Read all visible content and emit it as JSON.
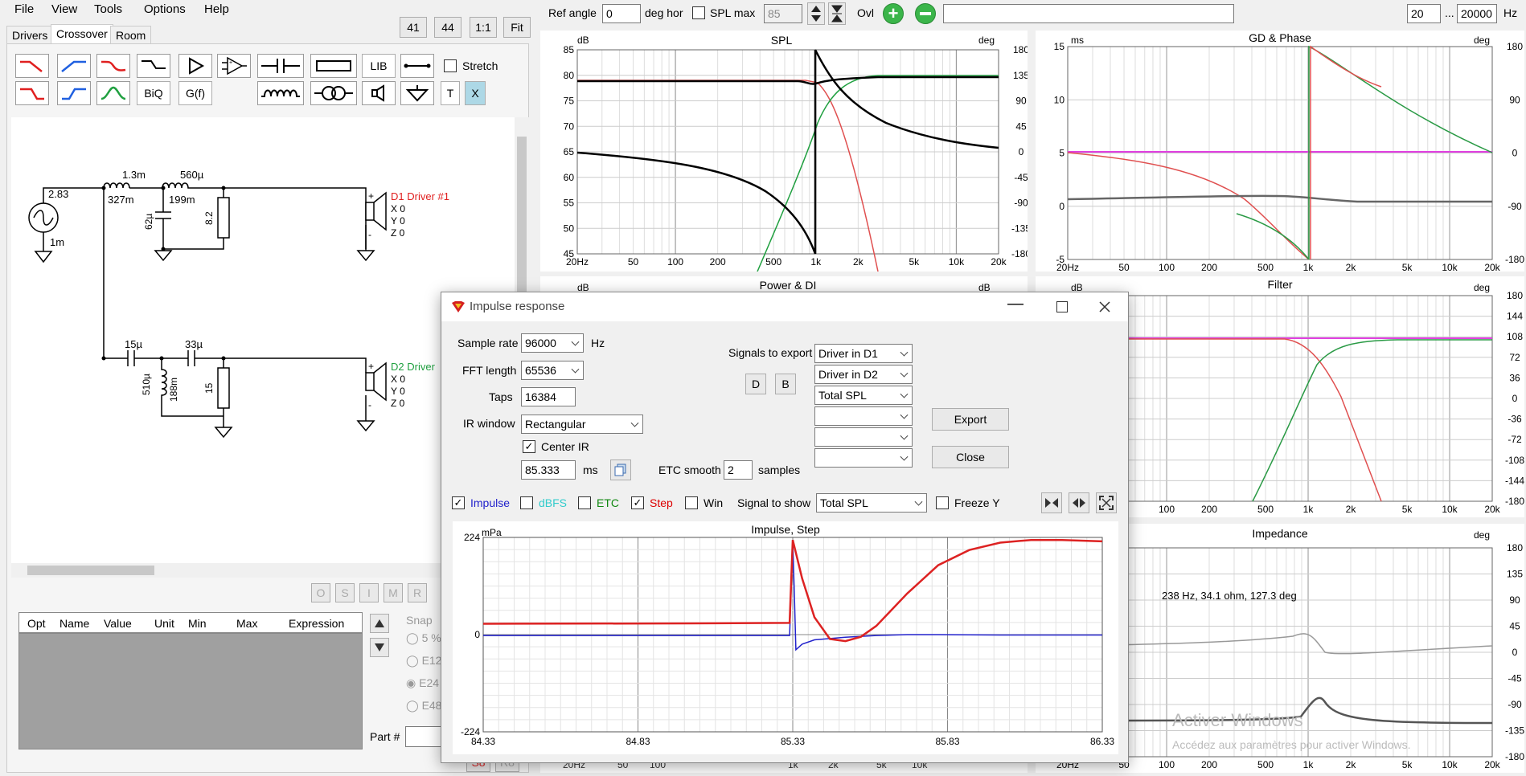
{
  "menu": [
    "File",
    "View",
    "Tools",
    "Options",
    "Help"
  ],
  "tabs": [
    "Drivers",
    "Crossover",
    "Room"
  ],
  "view_buttons": [
    "41",
    "44",
    "1:1",
    "Fit"
  ],
  "toolbar": {
    "lib_label": "LIB",
    "biq_label": "BiQ",
    "gf_label": "G(f)",
    "t_label": "T",
    "x_label": "X",
    "stretch_label": "Stretch"
  },
  "top_bar": {
    "ref_angle_label": "Ref angle",
    "ref_angle_value": "0",
    "deg_hor": "deg hor",
    "spl_max_label": "SPL max",
    "spl_max_value": "85",
    "ovl_label": "Ovl",
    "freq_min": "20",
    "freq_sep": "...",
    "freq_max": "20000",
    "hz": "Hz"
  },
  "schematic": {
    "gen_value": "2.83",
    "gen_r": "1m",
    "l1": "1.3m",
    "l1_r": "327m",
    "l2": "560µ",
    "l2_r": "199m",
    "c1": "62µ",
    "r1": "8.2",
    "d1_label": "D1 Driver #1",
    "d1_x": "X 0",
    "d1_y": "Y 0",
    "d1_z": "Z 0",
    "c2": "15µ",
    "c3": "33µ",
    "l3": "510µ",
    "l3_r": "188m",
    "r2": "15",
    "d2_label": "D2 Driver",
    "d2_x": "X 0",
    "d2_y": "Y 0",
    "d2_z": "Z 0",
    "plus": "+",
    "minus": "-"
  },
  "param_buttons": [
    "O",
    "S",
    "I",
    "M",
    "R"
  ],
  "param_table": {
    "headers": [
      "Opt",
      "Name",
      "Value",
      "Unit",
      "Min",
      "Max",
      "Expression"
    ]
  },
  "snap": {
    "label": "Snap",
    "options": [
      "5 %",
      "E12",
      "E24",
      "E48"
    ]
  },
  "part_label": "Part #",
  "bottom_buttons": [
    "S8",
    "R8"
  ],
  "graphs": {
    "spl": {
      "title": "SPL",
      "left_unit": "dB",
      "right_unit": "deg",
      "y_ticks": [
        "85",
        "80",
        "75",
        "70",
        "65",
        "60",
        "55",
        "50",
        "45"
      ],
      "right_ticks": [
        "180",
        "135",
        "90",
        "45",
        "0",
        "-45",
        "-90",
        "-135",
        "-180"
      ],
      "x_ticks": [
        "20Hz",
        "50",
        "100",
        "200",
        "500",
        "1k",
        "2k",
        "5k",
        "10k",
        "20k"
      ]
    },
    "gd": {
      "title": "GD & Phase",
      "left_unit": "ms",
      "right_unit": "deg",
      "y_ticks": [
        "15",
        "10",
        "5",
        "0",
        "-5"
      ],
      "right_ticks": [
        "180",
        "90",
        "0",
        "-90",
        "-180"
      ],
      "x_ticks": [
        "20Hz",
        "50",
        "100",
        "200",
        "500",
        "1k",
        "2k",
        "5k",
        "10k",
        "20k"
      ]
    },
    "power": {
      "title": "Power & DI",
      "left_unit": "dB",
      "right_unit": "dB",
      "bottom_ticks": [
        "20Hz",
        "50",
        "100",
        "1k",
        "2k",
        "5k",
        "10k"
      ]
    },
    "filter": {
      "title": "Filter",
      "left_unit": "dB",
      "right_unit": "deg",
      "right_ticks": [
        "180",
        "144",
        "108",
        "72",
        "36",
        "0",
        "-36",
        "-72",
        "-108",
        "-144",
        "-180"
      ],
      "x_ticks": [
        "100",
        "200",
        "500",
        "1k",
        "2k",
        "5k",
        "10k",
        "20k"
      ]
    },
    "impedance": {
      "title": "Impedance",
      "right_unit": "deg",
      "right_ticks": [
        "180",
        "135",
        "90",
        "45",
        "0",
        "-45",
        "-90",
        "-135",
        "-180"
      ],
      "x_ticks": [
        "20Hz",
        "50",
        "100",
        "200",
        "500",
        "1k",
        "2k",
        "5k",
        "10k",
        "20k"
      ],
      "readout": "238 Hz, 34.1 ohm, 127.3 deg"
    }
  },
  "watermark": {
    "line1": "Activer Windows",
    "line2": "Accédez aux paramètres pour activer Windows."
  },
  "dialog": {
    "title": "Impulse response",
    "sample_rate_label": "Sample rate",
    "sample_rate_value": "96000",
    "hz": "Hz",
    "fft_label": "FFT length",
    "fft_value": "65536",
    "taps_label": "Taps",
    "taps_value": "16384",
    "ir_window_label": "IR window",
    "ir_window_value": "Rectangular",
    "center_ir_label": "Center IR",
    "center_value": "85.333",
    "ms": "ms",
    "etc_smooth_label": "ETC smooth",
    "etc_smooth_value": "2",
    "samples": "samples",
    "signals_export_label": "Signals to export",
    "export_signals": [
      "Driver in D1",
      "Driver in D2",
      "Total SPL",
      "",
      "",
      ""
    ],
    "d_button": "D",
    "b_button": "B",
    "export_button": "Export",
    "close_button": "Close",
    "checkbox_labels": [
      "Impulse",
      "dBFS",
      "ETC",
      "Step",
      "Win"
    ],
    "checkbox_colors": [
      "#2222cc",
      "#33cccc",
      "#118811",
      "#dd0000",
      "#000000"
    ],
    "signal_show_label": "Signal to show",
    "signal_show_value": "Total SPL",
    "freeze_label": "Freeze Y"
  },
  "chart_data": {
    "type": "line",
    "title": "Impulse, Step",
    "ylabel": "mPa",
    "y_ticks": [
      "224",
      "0",
      "-224"
    ],
    "x_ticks": [
      "84.33",
      "84.83",
      "85.33",
      "85.83",
      "86.33"
    ],
    "xlim": [
      84.33,
      86.33
    ],
    "ylim": [
      -224,
      224
    ],
    "series": [
      {
        "name": "Impulse",
        "color": "#2222cc",
        "x": [
          84.33,
          85.0,
          85.32,
          85.33,
          85.335,
          85.34,
          85.36,
          85.4,
          85.5,
          85.6,
          85.7,
          85.8,
          86.0,
          86.33
        ],
        "y": [
          -2,
          -2,
          -2,
          215,
          100,
          -35,
          -22,
          -12,
          -6,
          -2,
          0,
          0,
          -1,
          -1
        ]
      },
      {
        "name": "Step",
        "color": "#dd2222",
        "x": [
          84.33,
          85.0,
          85.32,
          85.33,
          85.36,
          85.4,
          85.45,
          85.5,
          85.55,
          85.6,
          85.7,
          85.8,
          85.9,
          86.0,
          86.1,
          86.2,
          86.33
        ],
        "y": [
          25,
          26,
          27,
          218,
          130,
          40,
          -10,
          -15,
          -5,
          20,
          95,
          160,
          195,
          212,
          218,
          218,
          215
        ]
      }
    ]
  }
}
